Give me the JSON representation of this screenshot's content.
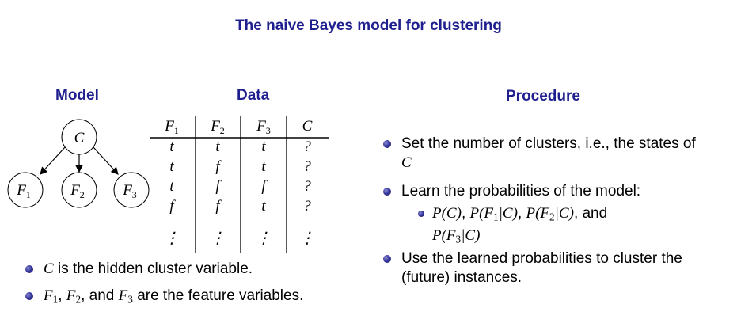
{
  "title": "The naive Bayes model for clustering",
  "model": {
    "heading": "Model",
    "root": "C",
    "children": [
      {
        "base": "F",
        "sub": "1"
      },
      {
        "base": "F",
        "sub": "2"
      },
      {
        "base": "F",
        "sub": "3"
      }
    ]
  },
  "data": {
    "heading": "Data",
    "columns": [
      {
        "base": "F",
        "sub": "1"
      },
      {
        "base": "F",
        "sub": "2"
      },
      {
        "base": "F",
        "sub": "3"
      },
      {
        "base": "C",
        "sub": ""
      }
    ],
    "rows": [
      [
        "t",
        "t",
        "t",
        "?"
      ],
      [
        "t",
        "f",
        "t",
        "?"
      ],
      [
        "t",
        "f",
        "f",
        "?"
      ],
      [
        "f",
        "f",
        "t",
        "?"
      ],
      [
        "⋮",
        "⋮",
        "⋮",
        "⋮"
      ]
    ]
  },
  "procedure": {
    "heading": "Procedure",
    "item1_text": "Set the number of clusters, i.e., the states of",
    "item1_var": "C",
    "item2_text": "Learn the probabilities of the model:",
    "sub_probs": [
      "P(C)",
      "P(F1|C)",
      "P(F2|C)"
    ],
    "sub_and": ", and",
    "sub_last": "P(F3|C)",
    "item3_line1": "Use the learned probabilities to cluster the",
    "item3_line2": "(future) instances."
  },
  "notes": {
    "n1_var": "C",
    "n1_text": "is the hidden cluster variable.",
    "n2_vars": [
      "F1",
      "F2",
      "F3"
    ],
    "n2_sep1": ",",
    "n2_sep2": ", and",
    "n2_text": "are the feature variables."
  },
  "colors": {
    "heading": "#1f1f8f",
    "bullet": "#3a3aa0"
  }
}
